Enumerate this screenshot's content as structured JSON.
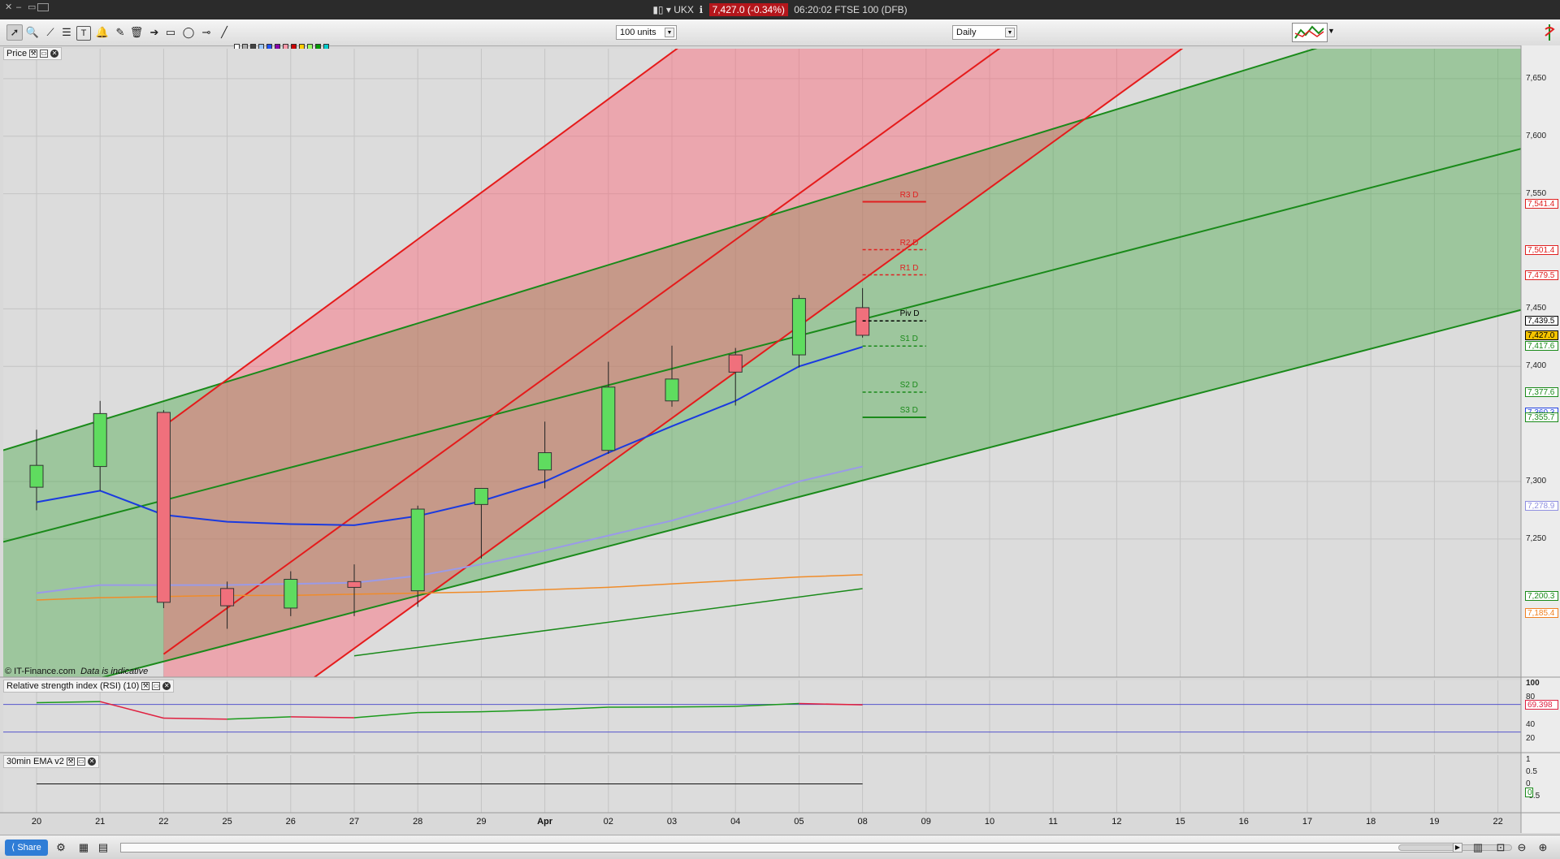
{
  "window": {
    "symbol": "UKX",
    "price_badge": "7,427.0 (-0.34%)",
    "time_and_name": "06:20:02 FTSE 100 (DFB)"
  },
  "toolbar": {
    "units_select": "100 units",
    "interval_select": "Daily",
    "text_tool": "T",
    "swatch_colors": [
      "#ffffff",
      "#d9d9d9",
      "#aaaaaa",
      "#777777",
      "#444444",
      "#000000",
      "#9ec9ff",
      "#6aa7ff",
      "#2255ff",
      "#0000aa",
      "#8800aa",
      "#cc00cc",
      "#ff99aa",
      "#ff3333",
      "#cc0000",
      "#aa6600",
      "#ffcc00",
      "#ffff00",
      "#99ff66",
      "#33cc33",
      "#009900",
      "#006600",
      "#00cccc",
      "#007777"
    ]
  },
  "panels": {
    "price_title": "Price",
    "rsi_title": "Relative strength index (RSI) (10)",
    "ema_title": "30min EMA v2",
    "watermark": "© IT-Finance.com",
    "indicative": "Data is indicative"
  },
  "price_axis": {
    "ticks": [
      {
        "label": "7,650",
        "value": 7650
      },
      {
        "label": "7,600",
        "value": 7600
      },
      {
        "label": "7,550",
        "value": 7550
      },
      {
        "label": "7,450",
        "value": 7450
      },
      {
        "label": "7,400",
        "value": 7400
      },
      {
        "label": "7,300",
        "value": 7300
      },
      {
        "label": "7,250",
        "value": 7250
      }
    ],
    "value_labels": [
      {
        "label": "7,541.4",
        "value": 7541.4,
        "color": "#e02020",
        "bg": "#fff"
      },
      {
        "label": "7,501.4",
        "value": 7501.4,
        "color": "#e02020",
        "bg": "#fff"
      },
      {
        "label": "7,479.5",
        "value": 7479.5,
        "color": "#e02020",
        "bg": "#fff"
      },
      {
        "label": "7,439.5",
        "value": 7439.5,
        "color": "#000000",
        "bg": "#fff"
      },
      {
        "label": "7,427.0",
        "value": 7427.0,
        "color": "#000000",
        "bg": "#f5c400"
      },
      {
        "label": "7,417.6",
        "value": 7417.6,
        "color": "#1a8a1a",
        "bg": "#fff"
      },
      {
        "label": "7,377.6",
        "value": 7377.6,
        "color": "#1a8a1a",
        "bg": "#fff"
      },
      {
        "label": "7,360.3",
        "value": 7360.3,
        "color": "#2040e0",
        "bg": "#fff"
      },
      {
        "label": "7,355.7",
        "value": 7355.7,
        "color": "#1a8a1a",
        "bg": "#fff"
      },
      {
        "label": "7,278.9",
        "value": 7278.9,
        "color": "#8f8fe0",
        "bg": "#fff"
      },
      {
        "label": "7,200.3",
        "value": 7200.3,
        "color": "#1a8a1a",
        "bg": "#fff"
      },
      {
        "label": "7,185.4",
        "value": 7185.4,
        "color": "#f08020",
        "bg": "#fff"
      }
    ]
  },
  "pivots": [
    {
      "label": "R3 D",
      "value": 7543,
      "color": "#e02020",
      "style": "solid"
    },
    {
      "label": "R2 D",
      "value": 7501.4,
      "color": "#e02020",
      "style": "dashed"
    },
    {
      "label": "R1 D",
      "value": 7479.5,
      "color": "#e02020",
      "style": "dashed"
    },
    {
      "label": "Piv D",
      "value": 7439.5,
      "color": "#000000",
      "style": "dashed"
    },
    {
      "label": "S1 D",
      "value": 7417.6,
      "color": "#1a8a1a",
      "style": "dashed"
    },
    {
      "label": "S2 D",
      "value": 7377.6,
      "color": "#1a8a1a",
      "style": "dashed"
    },
    {
      "label": "S3 D",
      "value": 7355.7,
      "color": "#1a8a1a",
      "style": "solid"
    }
  ],
  "rsi_axis": {
    "ticks": [
      {
        "label": "100",
        "value": 100
      },
      {
        "label": "80",
        "value": 80
      },
      {
        "label": "40",
        "value": 40
      },
      {
        "label": "20",
        "value": 20
      }
    ],
    "current_label": "69.398",
    "current_value": 69.398
  },
  "ema_axis": {
    "ticks": [
      {
        "label": "1",
        "value": 1
      },
      {
        "label": "0.5",
        "value": 0.5
      },
      {
        "label": "0",
        "value": 0
      },
      {
        "label": "-0.5",
        "value": -0.5
      }
    ],
    "current_label": "0"
  },
  "chart_data": {
    "type": "candlestick",
    "dates": [
      "20",
      "21",
      "22",
      "25",
      "26",
      "27",
      "28",
      "29",
      "Apr",
      "02",
      "03",
      "04",
      "05",
      "08",
      "09",
      "10",
      "11",
      "12",
      "15",
      "16",
      "17",
      "18",
      "19",
      "22"
    ],
    "candles": [
      {
        "date": "20",
        "open": 7295,
        "high": 7345,
        "low": 7275,
        "close": 7314
      },
      {
        "date": "21",
        "open": 7313,
        "high": 7370,
        "low": 7292,
        "close": 7359
      },
      {
        "date": "22",
        "open": 7360,
        "high": 7362,
        "low": 7190,
        "close": 7195
      },
      {
        "date": "25",
        "open": 7207,
        "high": 7213,
        "low": 7172,
        "close": 7192
      },
      {
        "date": "26",
        "open": 7190,
        "high": 7222,
        "low": 7183,
        "close": 7215
      },
      {
        "date": "27",
        "open": 7213,
        "high": 7228,
        "low": 7183,
        "close": 7208
      },
      {
        "date": "28",
        "open": 7205,
        "high": 7279,
        "low": 7191,
        "close": 7276
      },
      {
        "date": "29",
        "open": 7280,
        "high": 7294,
        "low": 7233,
        "close": 7294
      },
      {
        "date": "Apr",
        "open": 7310,
        "high": 7352,
        "low": 7294,
        "close": 7325
      },
      {
        "date": "02",
        "open": 7327,
        "high": 7404,
        "low": 7324,
        "close": 7382
      },
      {
        "date": "03",
        "open": 7370,
        "high": 7418,
        "low": 7365,
        "close": 7389
      },
      {
        "date": "04",
        "open": 7410,
        "high": 7416,
        "low": 7366,
        "close": 7395
      },
      {
        "date": "05",
        "open": 7410,
        "high": 7462,
        "low": 7399,
        "close": 7459
      },
      {
        "date": "08",
        "open": 7451,
        "high": 7468,
        "low": 7425,
        "close": 7427
      }
    ],
    "ema_blue": [
      7282,
      7292,
      7271,
      7265,
      7263,
      7262,
      7270,
      7283,
      7300,
      7325,
      7348,
      7370,
      7400,
      7417
    ],
    "ma_lavender": [
      7203,
      7210,
      7210,
      7210,
      7211,
      7212,
      7218,
      7228,
      7240,
      7253,
      7266,
      7282,
      7300,
      7313
    ],
    "ma_orange": [
      7197,
      7199,
      7200,
      7201,
      7201,
      7202,
      7203,
      7204,
      7206,
      7208,
      7211,
      7214,
      7217,
      7219
    ],
    "rsi": [
      72.5,
      74.2,
      50.1,
      48.7,
      52.1,
      50.7,
      58.3,
      59.4,
      62.2,
      66.1,
      66.3,
      67.2,
      71.4,
      69.398
    ],
    "ema30": [
      0,
      0,
      0,
      0,
      0,
      0,
      0,
      0,
      0,
      0,
      0,
      0,
      0,
      0
    ],
    "y_range": [
      7130,
      7676
    ],
    "rsi_range": [
      0,
      105
    ]
  }
}
